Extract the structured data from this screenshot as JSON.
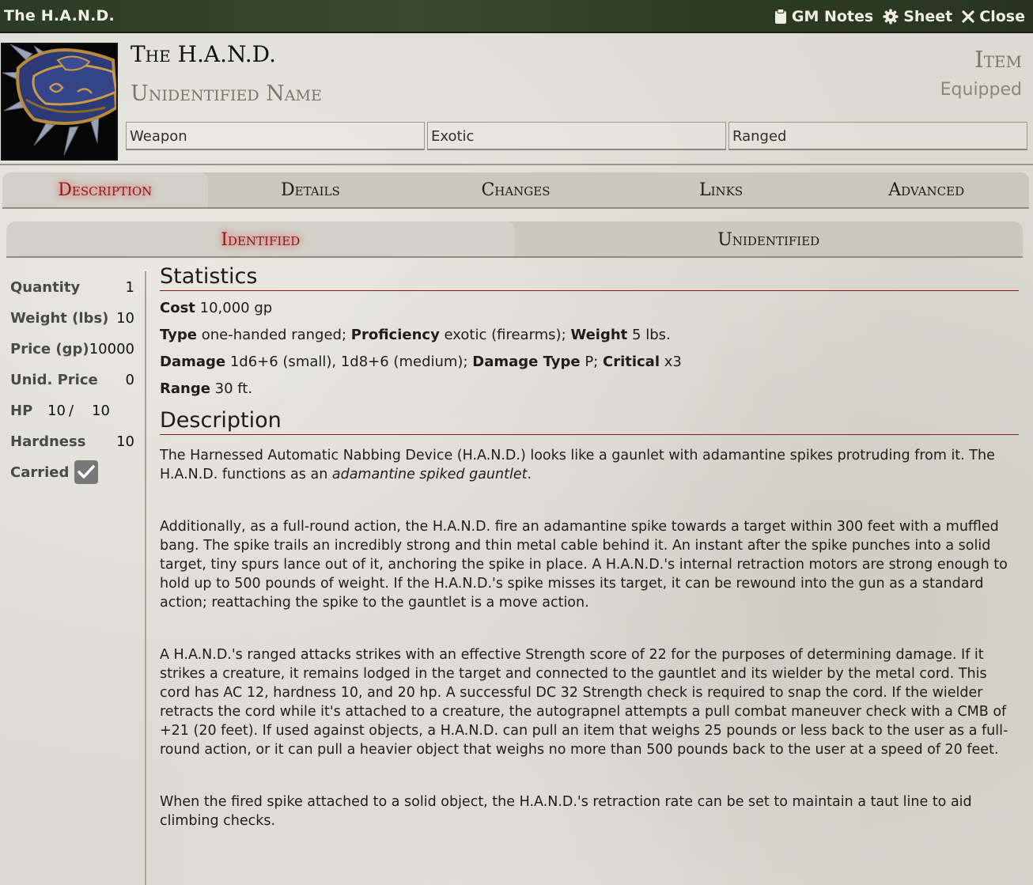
{
  "window": {
    "title": "The H.A.N.D.",
    "controls": [
      {
        "label": "GM Notes",
        "icon": "clipboard-icon"
      },
      {
        "label": "Sheet",
        "icon": "gear-icon"
      },
      {
        "label": "Close",
        "icon": "close-icon"
      }
    ]
  },
  "item": {
    "name": "The H.A.N.D.",
    "unidentified_name": "Unidentified Name",
    "type": "Item",
    "status": "Equipped",
    "subtypes": [
      "Weapon",
      "Exotic",
      "Ranged"
    ]
  },
  "tabs": {
    "primary": [
      "Description",
      "Details",
      "Changes",
      "Links",
      "Advanced"
    ],
    "secondary": [
      "Identified",
      "Unidentified"
    ]
  },
  "properties": {
    "quantity": {
      "label": "Quantity",
      "value": "1"
    },
    "weight": {
      "label": "Weight (lbs)",
      "value": "10"
    },
    "price": {
      "label": "Price (gp)",
      "value": "10000"
    },
    "unid_price": {
      "label": "Unid. Price",
      "value": "0"
    },
    "hp": {
      "label": "HP",
      "current": "10",
      "separator": "/",
      "max": "10"
    },
    "hardness": {
      "label": "Hardness",
      "value": "10"
    },
    "carried": {
      "label": "Carried",
      "checked": true
    }
  },
  "statistics": {
    "heading": "Statistics",
    "cost_label": "Cost",
    "cost": "10,000 gp",
    "type_label": "Type",
    "type": "one-handed ranged;",
    "proficiency_label": "Proficiency",
    "proficiency": "exotic (firearms);",
    "weight_label": "Weight",
    "weight": "5 lbs.",
    "damage_label": "Damage",
    "damage": "1d6+6 (small), 1d8+6 (medium);",
    "damage_type_label": "Damage Type",
    "damage_type": "P;",
    "critical_label": "Critical",
    "critical": "x3",
    "range_label": "Range",
    "range": "30 ft."
  },
  "description": {
    "heading": "Description",
    "p1_start": "The Harnessed Automatic Nabbing Device (H.A.N.D.) looks like a gaunlet with adamantine spikes protruding from it. The H.A.N.D. functions as an ",
    "p1_em": "adamantine spiked gauntlet",
    "p1_end": ".",
    "p2": "Additionally, as a full-round action, the H.A.N.D. fire an adamantine spike towards a target within 300 feet with a muffled bang. The spike trails an incredibly strong and thin metal cable behind it. An instant after the spike punches into a solid target, tiny spurs lance out of it, anchoring the spike in place. A H.A.N.D.'s internal retraction motors are strong enough to hold up to 500 pounds of weight. If the H.A.N.D.'s spike misses its target, it can be rewound into the gun as a standard action; reattaching the spike to the gauntlet is a move action.",
    "p3": "A H.A.N.D.'s ranged attacks strikes with an effective Strength score of 22 for the purposes of determining damage. If it strikes a creature, it remains lodged in the target and connected to the gauntlet and its wielder by the metal cord. This cord has AC 12, hardness 10, and 20 hp. A successful DC 32 Strength check is required to snap the cord. If the wielder retracts the cord while it's attached to a creature, the autograpnel attempts a pull combat maneuver check with a CMB of +21 (20 feet). If used against objects, a H.A.N.D. can pull an item that weighs 25 pounds or less back to the user as a full-round action, or it can pull a heavier object that weighs no more than 500 pounds back to the user at a speed of 20 feet.",
    "p4": "When the fired spike attached to a solid object, the H.A.N.D.'s retraction rate can be set to maintain a taut line to aid climbing checks."
  },
  "colors": {
    "active_tab": "#8a1a15",
    "header_bg": "#2b3a25",
    "accent_rule": "#8a1a15"
  }
}
